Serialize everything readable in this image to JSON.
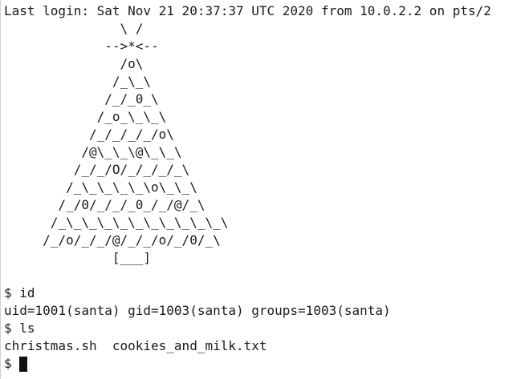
{
  "terminal": {
    "login_line": "Last login: Sat Nov 21 20:37:37 UTC 2020 from 10.0.2.2 on pts/2",
    "tree": [
      "               \\ /",
      "             -->*<--",
      "               /o\\",
      "              /_\\_\\",
      "             /_/_0_\\",
      "            /_o_\\_\\_\\",
      "           /_/_/_/_/o\\",
      "          /@\\_\\_\\@\\_\\_\\",
      "         /_/_/O/_/_/_/_\\",
      "        /_\\_\\_\\_\\_\\o\\_\\_\\",
      "       /_/0/_/_/_0_/_/@/_\\",
      "      /_\\_\\_\\_\\_\\_\\_\\_\\_\\_\\_\\",
      "     /_/o/_/_/@/_/_/o/_/0/_\\",
      "              [___]"
    ],
    "blank": "",
    "cmd1": "$ id",
    "out1": "uid=1001(santa) gid=1003(santa) groups=1003(santa)",
    "cmd2": "$ ls",
    "out2": "christmas.sh  cookies_and_milk.txt",
    "prompt": "$ "
  }
}
